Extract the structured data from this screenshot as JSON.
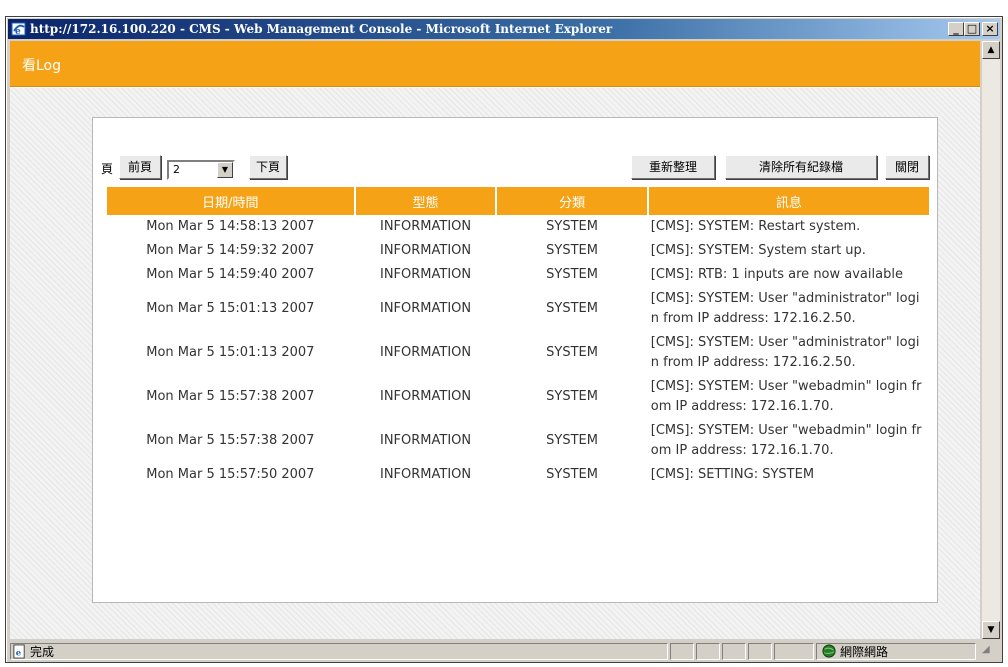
{
  "window": {
    "title": "http://172.16.100.220 - CMS - Web Management Console - Microsoft Internet Explorer"
  },
  "banner": {
    "title": "看Log"
  },
  "pager": {
    "label": "頁",
    "prev_label": "前頁",
    "selected_page": "2",
    "next_label": "下頁"
  },
  "actions": {
    "refresh_label": "重新整理",
    "clear_all_label": "清除所有紀錄檔",
    "close_label": "關閉"
  },
  "table": {
    "headers": [
      "日期/時間",
      "型態",
      "分類",
      "訊息"
    ],
    "rows": [
      [
        "Mon Mar 5 14:58:13 2007",
        "INFORMATION",
        "SYSTEM",
        "[CMS]: SYSTEM: Restart system."
      ],
      [
        "Mon Mar 5 14:59:32 2007",
        "INFORMATION",
        "SYSTEM",
        "[CMS]: SYSTEM: System start up."
      ],
      [
        "Mon Mar 5 14:59:40 2007",
        "INFORMATION",
        "SYSTEM",
        "[CMS]: RTB: 1 inputs are now available"
      ],
      [
        "Mon Mar 5 15:01:13 2007",
        "INFORMATION",
        "SYSTEM",
        "[CMS]: SYSTEM: User \"administrator\" login from IP address: 172.16.2.50."
      ],
      [
        "Mon Mar 5 15:01:13 2007",
        "INFORMATION",
        "SYSTEM",
        "[CMS]: SYSTEM: User \"administrator\" login from IP address: 172.16.2.50."
      ],
      [
        "Mon Mar 5 15:57:38 2007",
        "INFORMATION",
        "SYSTEM",
        "[CMS]: SYSTEM: User \"webadmin\" login from IP address: 172.16.1.70."
      ],
      [
        "Mon Mar 5 15:57:38 2007",
        "INFORMATION",
        "SYSTEM",
        "[CMS]: SYSTEM: User \"webadmin\" login from IP address: 172.16.1.70."
      ],
      [
        "Mon Mar 5 15:57:50 2007",
        "INFORMATION",
        "SYSTEM",
        "[CMS]: SETTING: SYSTEM"
      ]
    ]
  },
  "statusbar": {
    "status_text": "完成",
    "zone_text": "網際網路"
  },
  "colors": {
    "accent": "#f6a216",
    "title_bar": "#0a246a"
  },
  "icons": {
    "title": "ie-icon",
    "status": "page-done-icon",
    "zone": "internet-globe-icon"
  }
}
